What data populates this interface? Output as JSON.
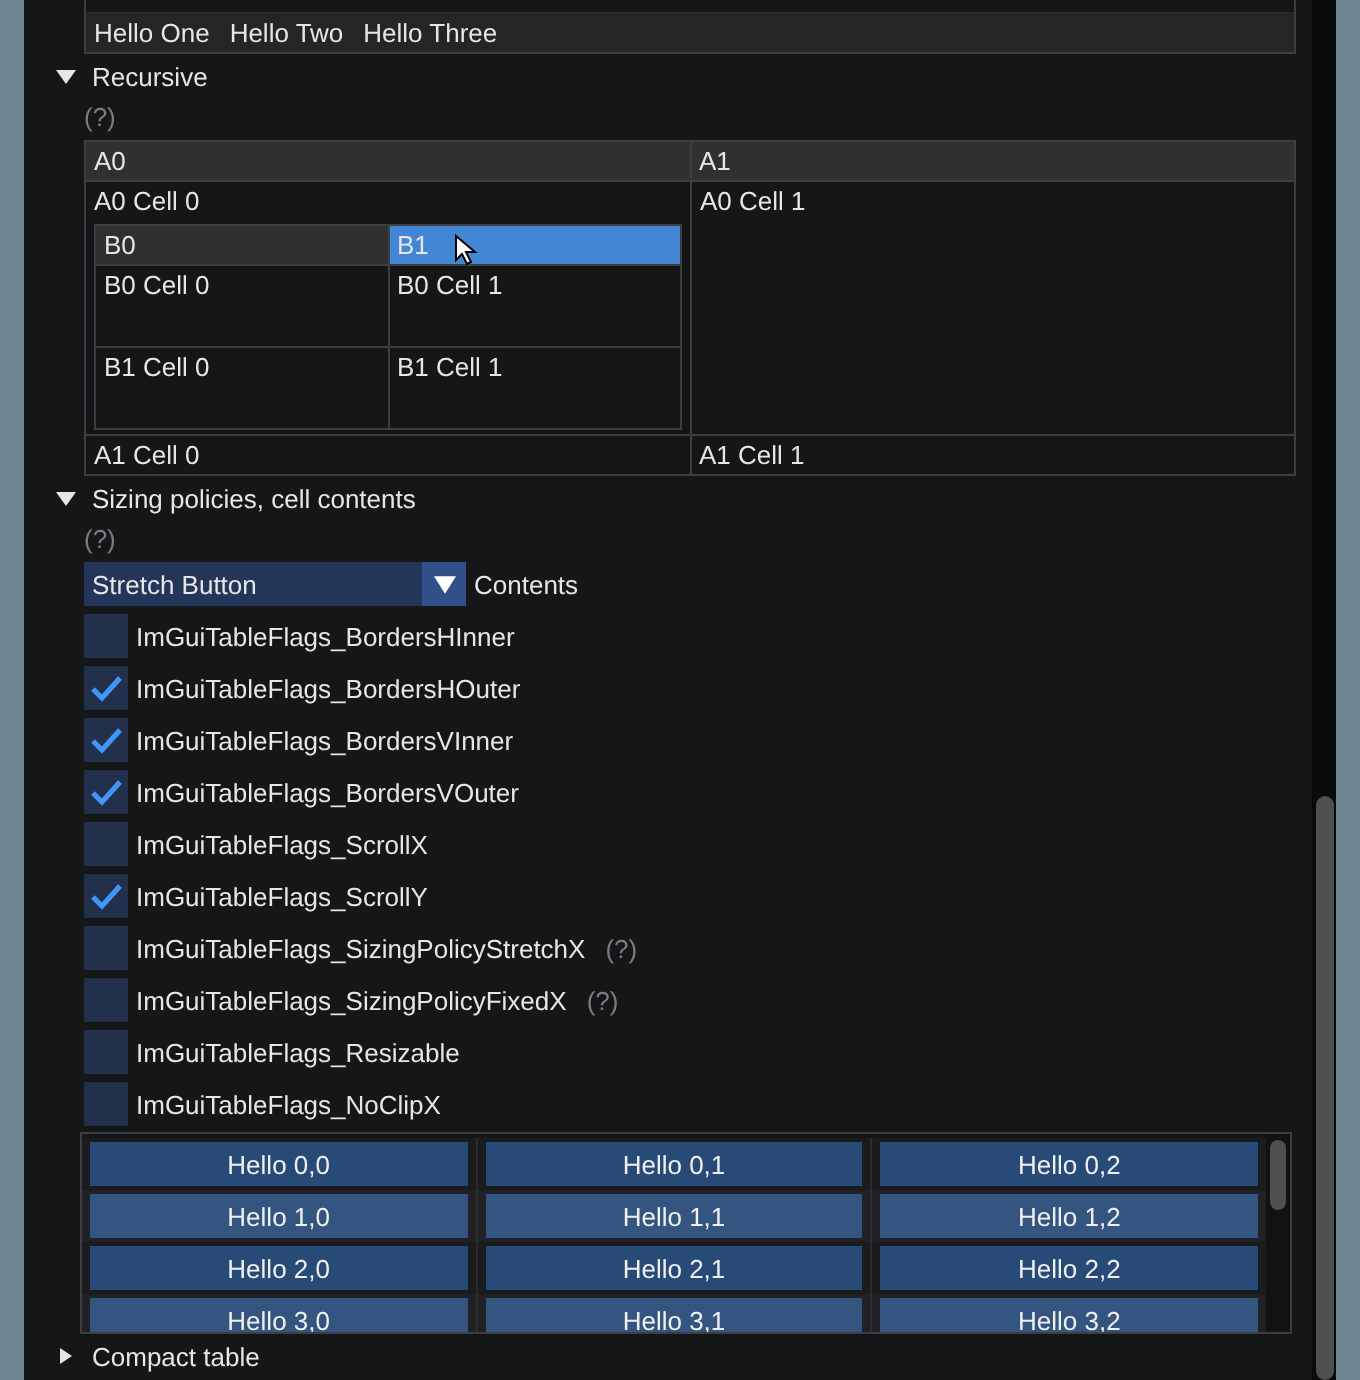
{
  "top_table": {
    "rows": [
      {
        "cells": [
          "Hello One",
          "Hello Two",
          "Hello Three"
        ]
      }
    ]
  },
  "recursive": {
    "title": "Recursive",
    "expanded": true,
    "help": "(?)",
    "table": {
      "columns": [
        "A0",
        "A1"
      ],
      "rows": [
        {
          "cells": [
            "A0 Cell 0",
            "A0 Cell 1"
          ],
          "nested": {
            "columns": [
              {
                "label": "B0",
                "selected": false
              },
              {
                "label": "B1",
                "selected": true
              }
            ],
            "rows": [
              {
                "cells": [
                  "B0 Cell 0",
                  "B0 Cell 1"
                ]
              },
              {
                "cells": [
                  "B1 Cell 0",
                  "B1 Cell 1"
                ]
              }
            ]
          }
        },
        {
          "cells": [
            "A1 Cell 0",
            "A1 Cell 1"
          ]
        }
      ]
    }
  },
  "sizing": {
    "title": "Sizing policies, cell contents",
    "expanded": true,
    "help": "(?)",
    "combo": {
      "value": "Stretch Button",
      "label": "Contents"
    },
    "flags": [
      {
        "label": "ImGuiTableFlags_BordersHInner",
        "checked": false
      },
      {
        "label": "ImGuiTableFlags_BordersHOuter",
        "checked": true
      },
      {
        "label": "ImGuiTableFlags_BordersVInner",
        "checked": true
      },
      {
        "label": "ImGuiTableFlags_BordersVOuter",
        "checked": true
      },
      {
        "label": "ImGuiTableFlags_ScrollX",
        "checked": false
      },
      {
        "label": "ImGuiTableFlags_ScrollY",
        "checked": true
      },
      {
        "label": "ImGuiTableFlags_SizingPolicyStretchX",
        "checked": false,
        "help": "(?)"
      },
      {
        "label": "ImGuiTableFlags_SizingPolicyFixedX",
        "checked": false,
        "help": "(?)"
      },
      {
        "label": "ImGuiTableFlags_Resizable",
        "checked": false
      },
      {
        "label": "ImGuiTableFlags_NoClipX",
        "checked": false
      }
    ],
    "table": {
      "rows": [
        [
          "Hello 0,0",
          "Hello 0,1",
          "Hello 0,2"
        ],
        [
          "Hello 1,0",
          "Hello 1,1",
          "Hello 1,2"
        ],
        [
          "Hello 2,0",
          "Hello 2,1",
          "Hello 2,2"
        ],
        [
          "Hello 3,0",
          "Hello 3,1",
          "Hello 3,2"
        ]
      ]
    }
  },
  "compact": {
    "title": "Compact table",
    "expanded": false
  }
}
